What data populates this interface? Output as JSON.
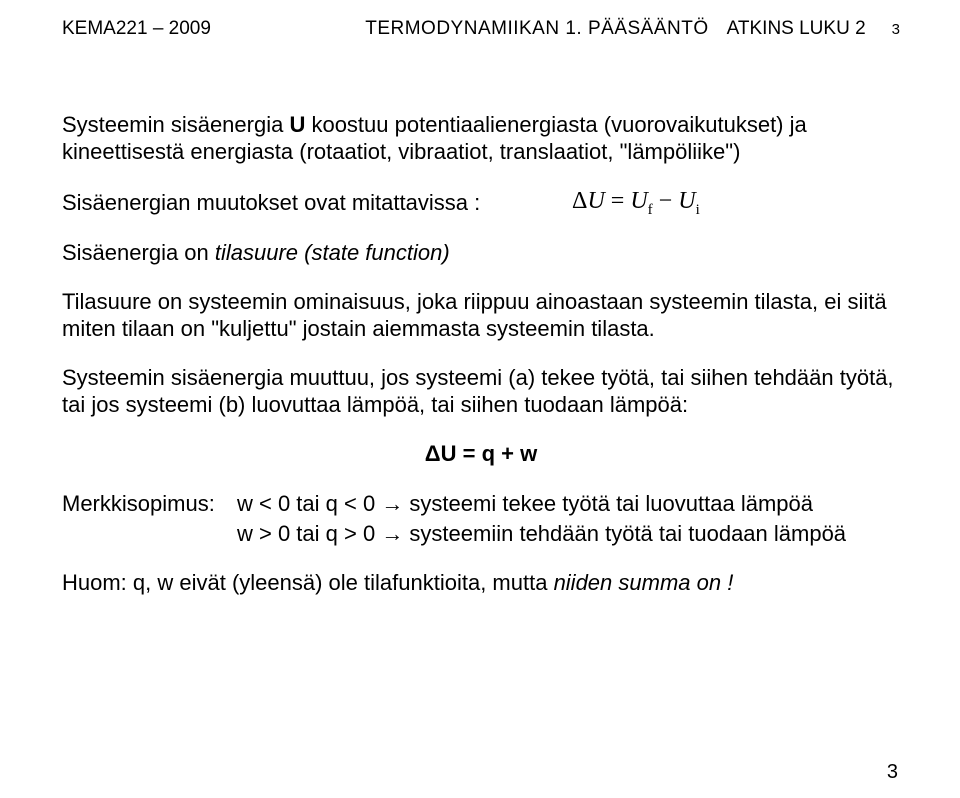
{
  "header": {
    "left": "KEMA221 – 2009",
    "center": "TERMODYNAMIIKAN 1. PÄÄSÄÄNTÖ",
    "right": "ATKINS LUKU 2",
    "pagenum_top": "3"
  },
  "p1_a": "Systeemin sisäenergia ",
  "p1_U": "U",
  "p1_b": " koostuu potentiaalienergiasta (vuorovaikutukset) ja kineettisestä energiasta (rotaatiot, vibraatiot, translaatiot, \"lämpöliike\")",
  "mitta_label": "Sisäenergian muutokset ovat mitattavissa :",
  "formula": {
    "delta": "Δ",
    "U": "U",
    "eq": " = ",
    "Uf": "U",
    "f": "f",
    "minus": " − ",
    "Ui": "U",
    "i": "i"
  },
  "p3_a": "Sisäenergia on ",
  "p3_it": "tilasuure  (state function)",
  "p4": "Tilasuure on systeemin ominaisuus, joka riippuu ainoastaan systeemin tilasta, ei siitä miten tilaan on \"kuljettu\" jostain aiemmasta systeemin tilasta.",
  "p5": "Systeemin sisäenergia muuttuu, jos systeemi (a) tekee työtä, tai siihen tehdään työtä, tai jos systeemi (b) luovuttaa lämpöä, tai siihen tuodaan lämpöä:",
  "eq_center": "ΔU = q + w",
  "sign": {
    "prefix": "Merkkisopimus:",
    "r1a": "w < 0   tai  q < 0 ",
    "arrow": "→",
    "r1b": " systeemi tekee työtä tai luovuttaa lämpöä",
    "r2a": "w > 0   tai  q > 0 ",
    "r2b": " systeemiin tehdään työtä tai tuodaan lämpöä"
  },
  "p6_a": "Huom:  q, w eivät (yleensä) ole tilafunktioita, mutta ",
  "p6_it": "niiden summa on !",
  "pagenum_bottom": "3"
}
